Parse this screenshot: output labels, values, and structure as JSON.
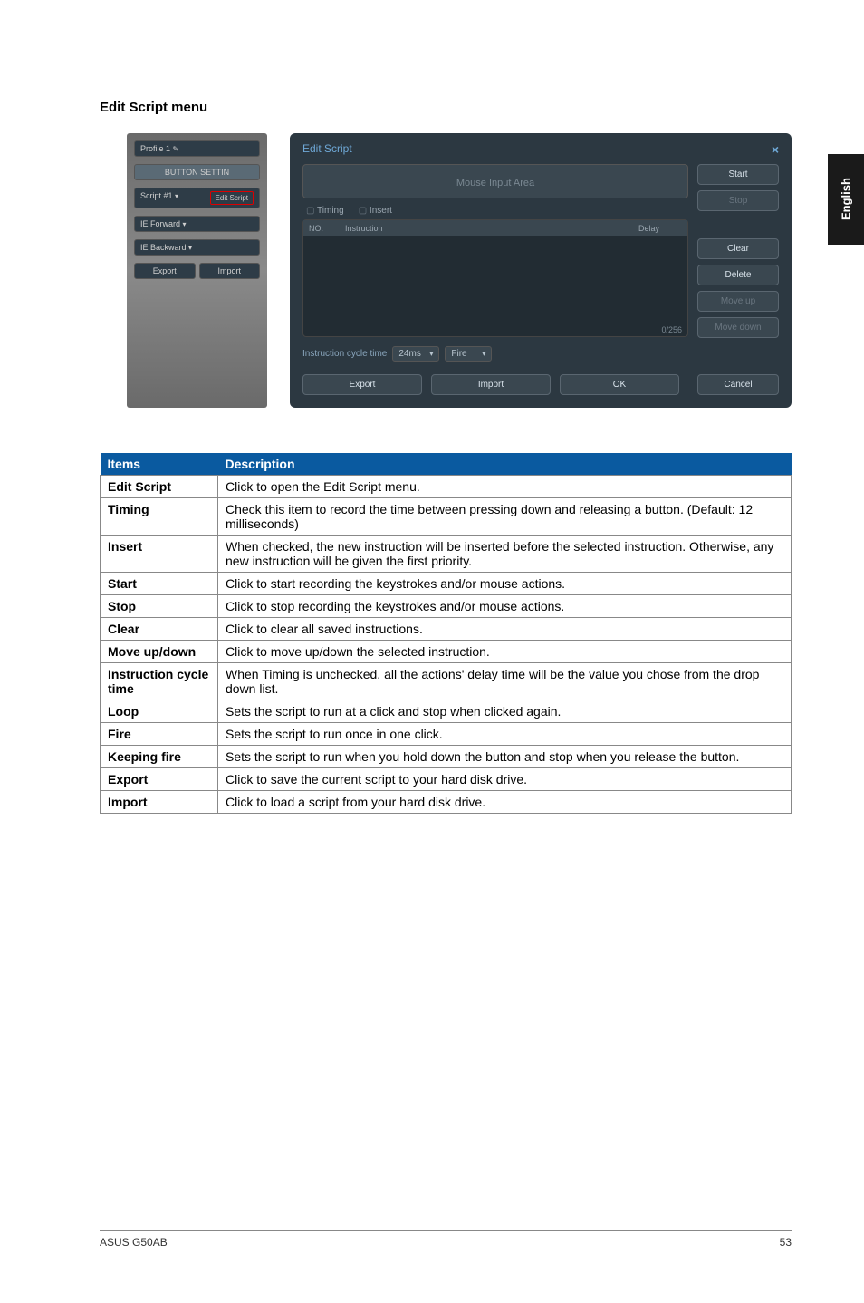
{
  "side_tab": "English",
  "section_title": "Edit Script menu",
  "left_panel": {
    "profile": "Profile 1",
    "button_settin": "BUTTON SETTIN",
    "script": "Script #1",
    "edit_script": "Edit Script",
    "ie_forward": "IE Forward",
    "ie_backward": "IE Backward",
    "export": "Export",
    "import": "Import"
  },
  "edit_window": {
    "title": "Edit Script",
    "mouse_input": "Mouse Input Area",
    "timing_cb": "Timing",
    "insert_cb": "Insert",
    "col_no": "NO.",
    "col_instruction": "Instruction",
    "col_delay": "Delay",
    "counter": "0/256",
    "cycle_label": "Instruction cycle time",
    "cycle_value": "24ms",
    "fire_sel": "Fire",
    "start": "Start",
    "stop": "Stop",
    "clear": "Clear",
    "delete": "Delete",
    "moveup": "Move up",
    "movedown": "Move down",
    "export": "Export",
    "import": "Import",
    "ok": "OK",
    "cancel": "Cancel"
  },
  "table": {
    "h_items": "Items",
    "h_desc": "Description",
    "rows": [
      {
        "item": "Edit Script",
        "desc": "Click to open the Edit Script menu."
      },
      {
        "item": "Timing",
        "desc": "Check this item to record the time between pressing down and releasing a button. (Default: 12 milliseconds)"
      },
      {
        "item": "Insert",
        "desc": "When checked, the new instruction will be inserted before the selected instruction. Otherwise, any new instruction will be given the first priority."
      },
      {
        "item": "Start",
        "desc": "Click to start recording the keystrokes and/or mouse actions."
      },
      {
        "item": "Stop",
        "desc": "Click to stop recording the keystrokes and/or mouse actions."
      },
      {
        "item": "Clear",
        "desc": "Click to clear all saved instructions."
      },
      {
        "item": "Move up/down",
        "desc": "Click to move up/down the selected instruction."
      },
      {
        "item": "Instruction cycle time",
        "desc": "When Timing is unchecked, all the actions' delay time will be the value you chose from the drop down list."
      },
      {
        "item": "Loop",
        "desc": "Sets the script to run at a click and stop when clicked again."
      },
      {
        "item": "Fire",
        "desc": "Sets the script to run once in one click."
      },
      {
        "item": "Keeping fire",
        "desc": "Sets the script to run when you hold down the button and stop when you release the button."
      },
      {
        "item": "Export",
        "desc": "Click to save the current script to your hard disk drive."
      },
      {
        "item": "Import",
        "desc": "Click to load a script from your hard disk drive."
      }
    ]
  },
  "footer": {
    "left": "ASUS G50AB",
    "right": "53"
  }
}
